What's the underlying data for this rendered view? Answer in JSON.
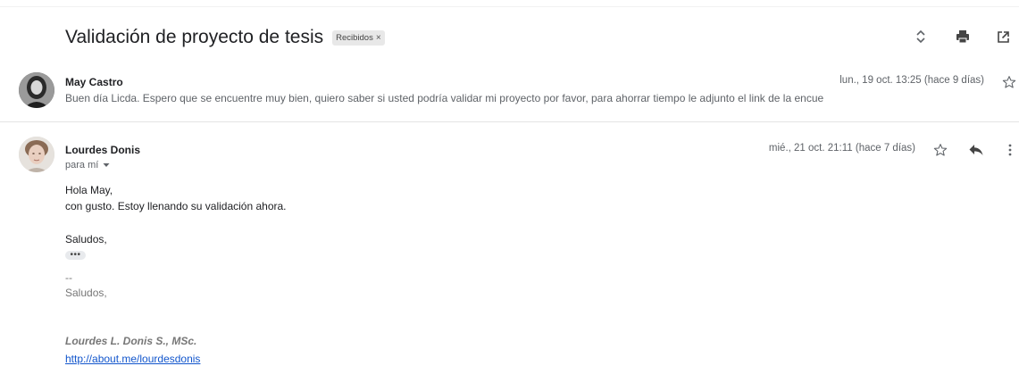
{
  "thread": {
    "subject": "Validación de proyecto de tesis",
    "label_chip": "Recibidos",
    "label_remove": "×"
  },
  "toolbar": {
    "icons": [
      "expand-collapse-icon",
      "print-icon",
      "open-in-new-window-icon"
    ]
  },
  "messages": [
    {
      "sender": "May Castro",
      "date": "lun., 19 oct. 13:25 (hace 9 días)",
      "snippet": "Buen día Licda. Espero que se encuentre muy bien, quiero saber si usted podría validar mi proyecto por favor, para ahorrar tiempo le adjunto el link de la encue"
    },
    {
      "sender": "Lourdes Donis",
      "date": "mié., 21 oct. 21:11 (hace 7 días)",
      "recipient": "para mí",
      "body_lines": [
        "Hola May,",
        "con gusto. Estoy llenando su validación ahora.",
        "Saludos,"
      ],
      "trimmed_content": "•••",
      "signature_separator": "--",
      "signature_greeting": "Saludos,",
      "signature_name": "Lourdes L. Donis S., MSc.",
      "signature_link": "http://about.me/lourdesdonis"
    }
  ],
  "colors": {
    "link": "#1155cc",
    "muted": "#5f6368",
    "chip_bg": "#e8e8e8"
  }
}
